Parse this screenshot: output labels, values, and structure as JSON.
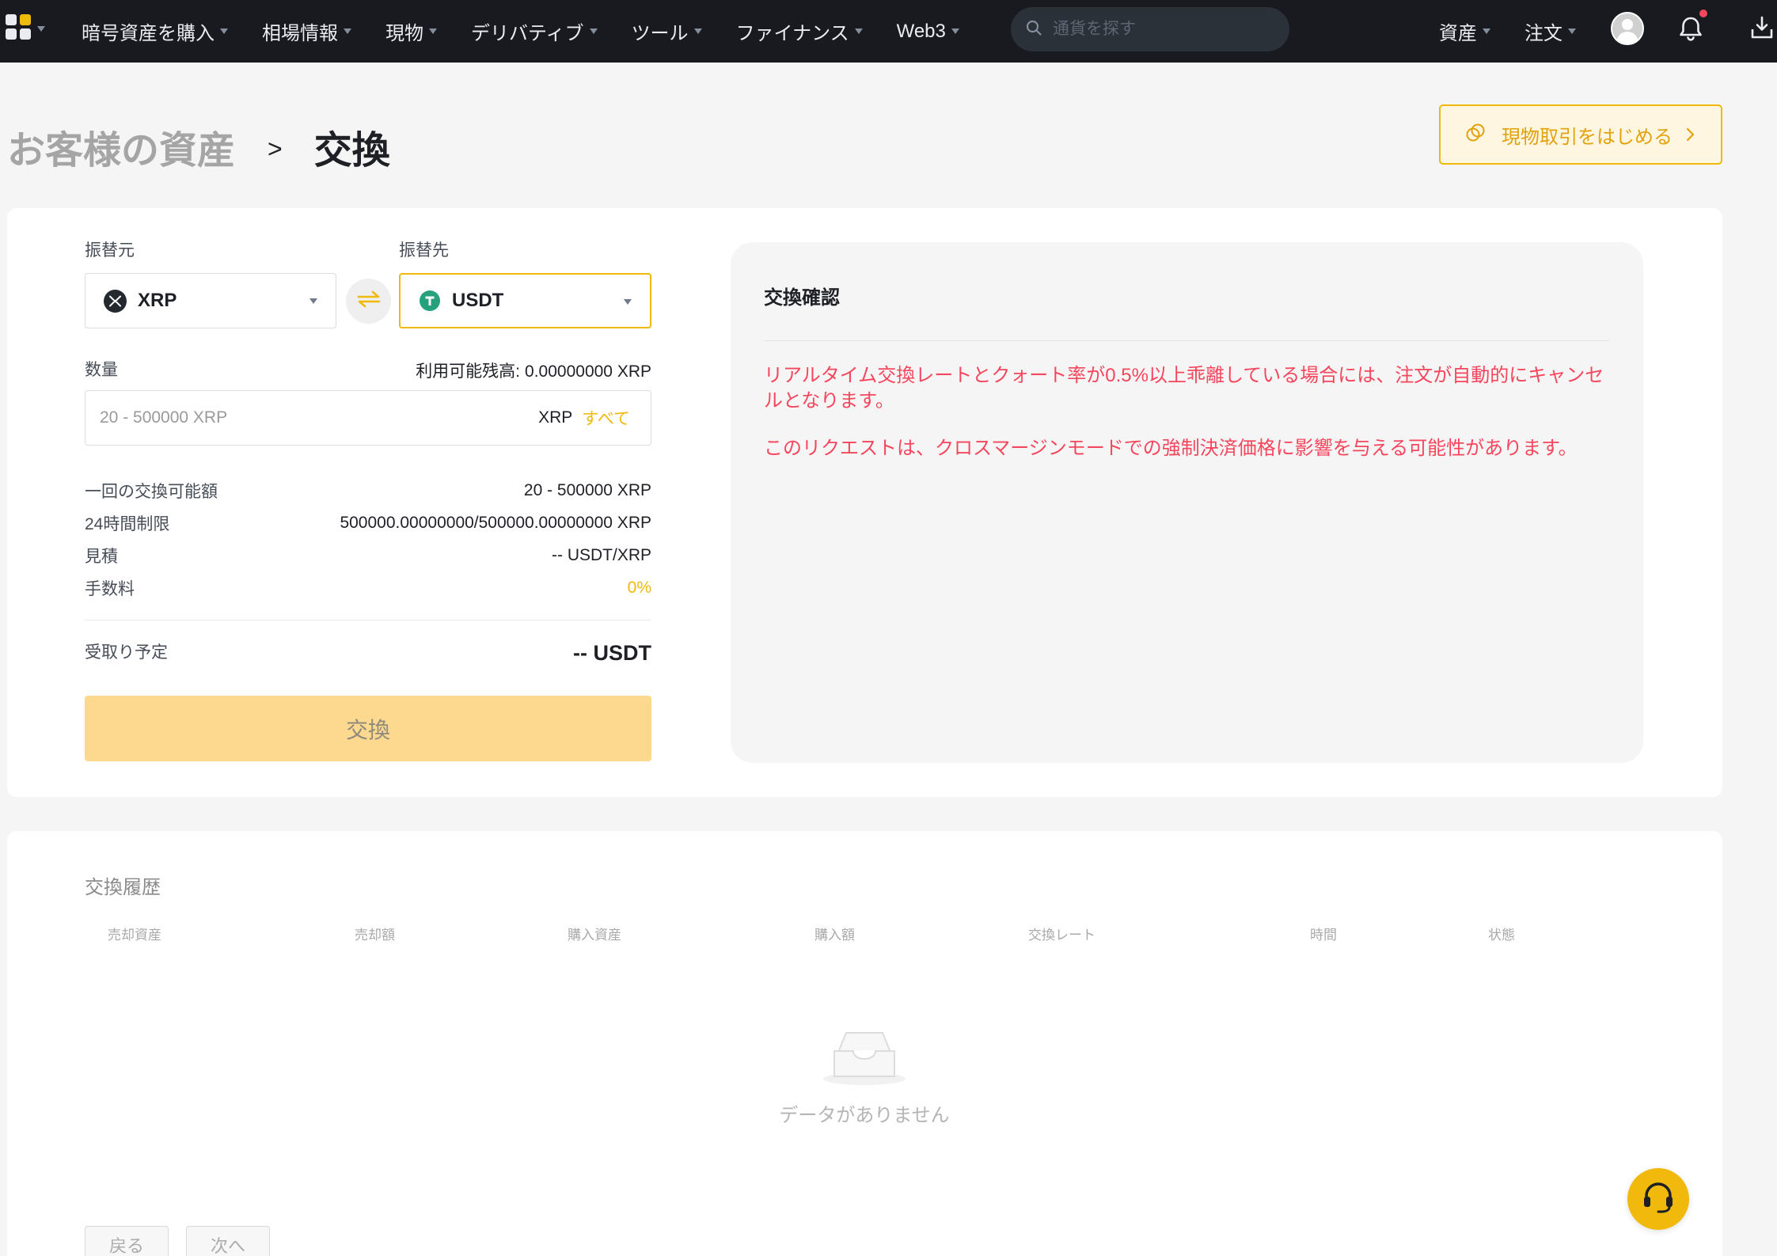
{
  "colors": {
    "accent": "#F0B90B",
    "nav_bg": "#181A20",
    "error": "#F6465D",
    "page_bg": "#F5F5F5"
  },
  "icons": {
    "apps": "apps-grid-icon",
    "search": "search-icon",
    "avatar": "user-avatar",
    "notifications": "bell-icon",
    "download": "download-icon",
    "spot_trade": "spot-trade-icon",
    "from_coin": "xrp-coin-icon",
    "to_coin": "usdt-coin-icon",
    "swap": "swap-arrows-icon",
    "empty": "empty-inbox-icon",
    "support": "headset-icon"
  },
  "nav": {
    "items": [
      {
        "label": "暗号資産を購入"
      },
      {
        "label": "相場情報"
      },
      {
        "label": "現物"
      },
      {
        "label": "デリバティブ"
      },
      {
        "label": "ツール"
      },
      {
        "label": "ファイナンス"
      },
      {
        "label": "Web3"
      }
    ],
    "search_placeholder": "通貨を探す",
    "assets": "資産",
    "orders": "注文",
    "has_unread_notification": true
  },
  "breadcrumb": {
    "parent": "お客様の資産",
    "separator": ">",
    "current": "交換"
  },
  "start_spot_button": "現物取引をはじめる",
  "convert": {
    "from_label": "振替元",
    "to_label": "振替先",
    "from_coin": "XRP",
    "to_coin": "USDT",
    "amount_label": "数量",
    "available_label": "利用可能残高:",
    "available_value": "0.00000000 XRP",
    "amount_placeholder": "20 - 500000 XRP",
    "amount_unit": "XRP",
    "max_label": "すべて",
    "info": [
      {
        "label": "一回の交換可能額",
        "value": "20 - 500000 XRP"
      },
      {
        "label": "24時間制限",
        "value": "500000.00000000/500000.00000000 XRP"
      },
      {
        "label": "見積",
        "value": "-- USDT/XRP"
      },
      {
        "label": "手数料",
        "value": "0%"
      }
    ],
    "receive_label": "受取り予定",
    "receive_value": "-- USDT",
    "submit_label": "交換"
  },
  "confirm": {
    "title": "交換確認",
    "notices": [
      "リアルタイム交換レートとクォート率が0.5%以上乖離している場合には、注文が自動的にキャンセルとなります。",
      "このリクエストは、クロスマージンモードでの強制決済価格に影響を与える可能性があります。"
    ]
  },
  "history": {
    "title": "交換履歴",
    "columns": [
      "売却資産",
      "売却額",
      "購入資産",
      "購入額",
      "交換レート",
      "時間",
      "状態"
    ],
    "empty_text": "データがありません",
    "prev_label": "戻る",
    "next_label": "次へ"
  }
}
